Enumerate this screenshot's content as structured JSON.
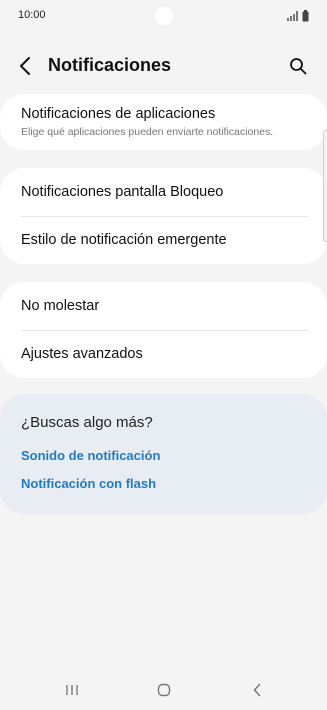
{
  "status_bar": {
    "time": "10:00",
    "icons": [
      "signal-icon",
      "battery-icon"
    ]
  },
  "header": {
    "back_icon": "chevron-left-icon",
    "title": "Notificaciones",
    "search_icon": "search-icon"
  },
  "settings": {
    "app_notifications": {
      "title": "Notificaciones de aplicaciones",
      "subtitle": "Elige qué aplicaciones pueden enviarte notificaciones."
    },
    "lock_screen": {
      "title": "Notificaciones pantalla Bloqueo"
    },
    "popup_style": {
      "title": "Estilo de notificación emergente"
    },
    "do_not_disturb": {
      "title": "No molestar"
    },
    "advanced": {
      "title": "Ajustes avanzados"
    }
  },
  "suggestions": {
    "title": "¿Buscas algo más?",
    "links": [
      "Sonido de notificación",
      "Notificación con flash"
    ]
  },
  "nav_bar": {
    "icons": [
      "recents-icon",
      "home-icon",
      "back-icon"
    ]
  },
  "colors": {
    "background": "#f4f4f4",
    "card": "#ffffff",
    "suggestion_card": "#e8edf4",
    "link": "#1f7ac9"
  }
}
